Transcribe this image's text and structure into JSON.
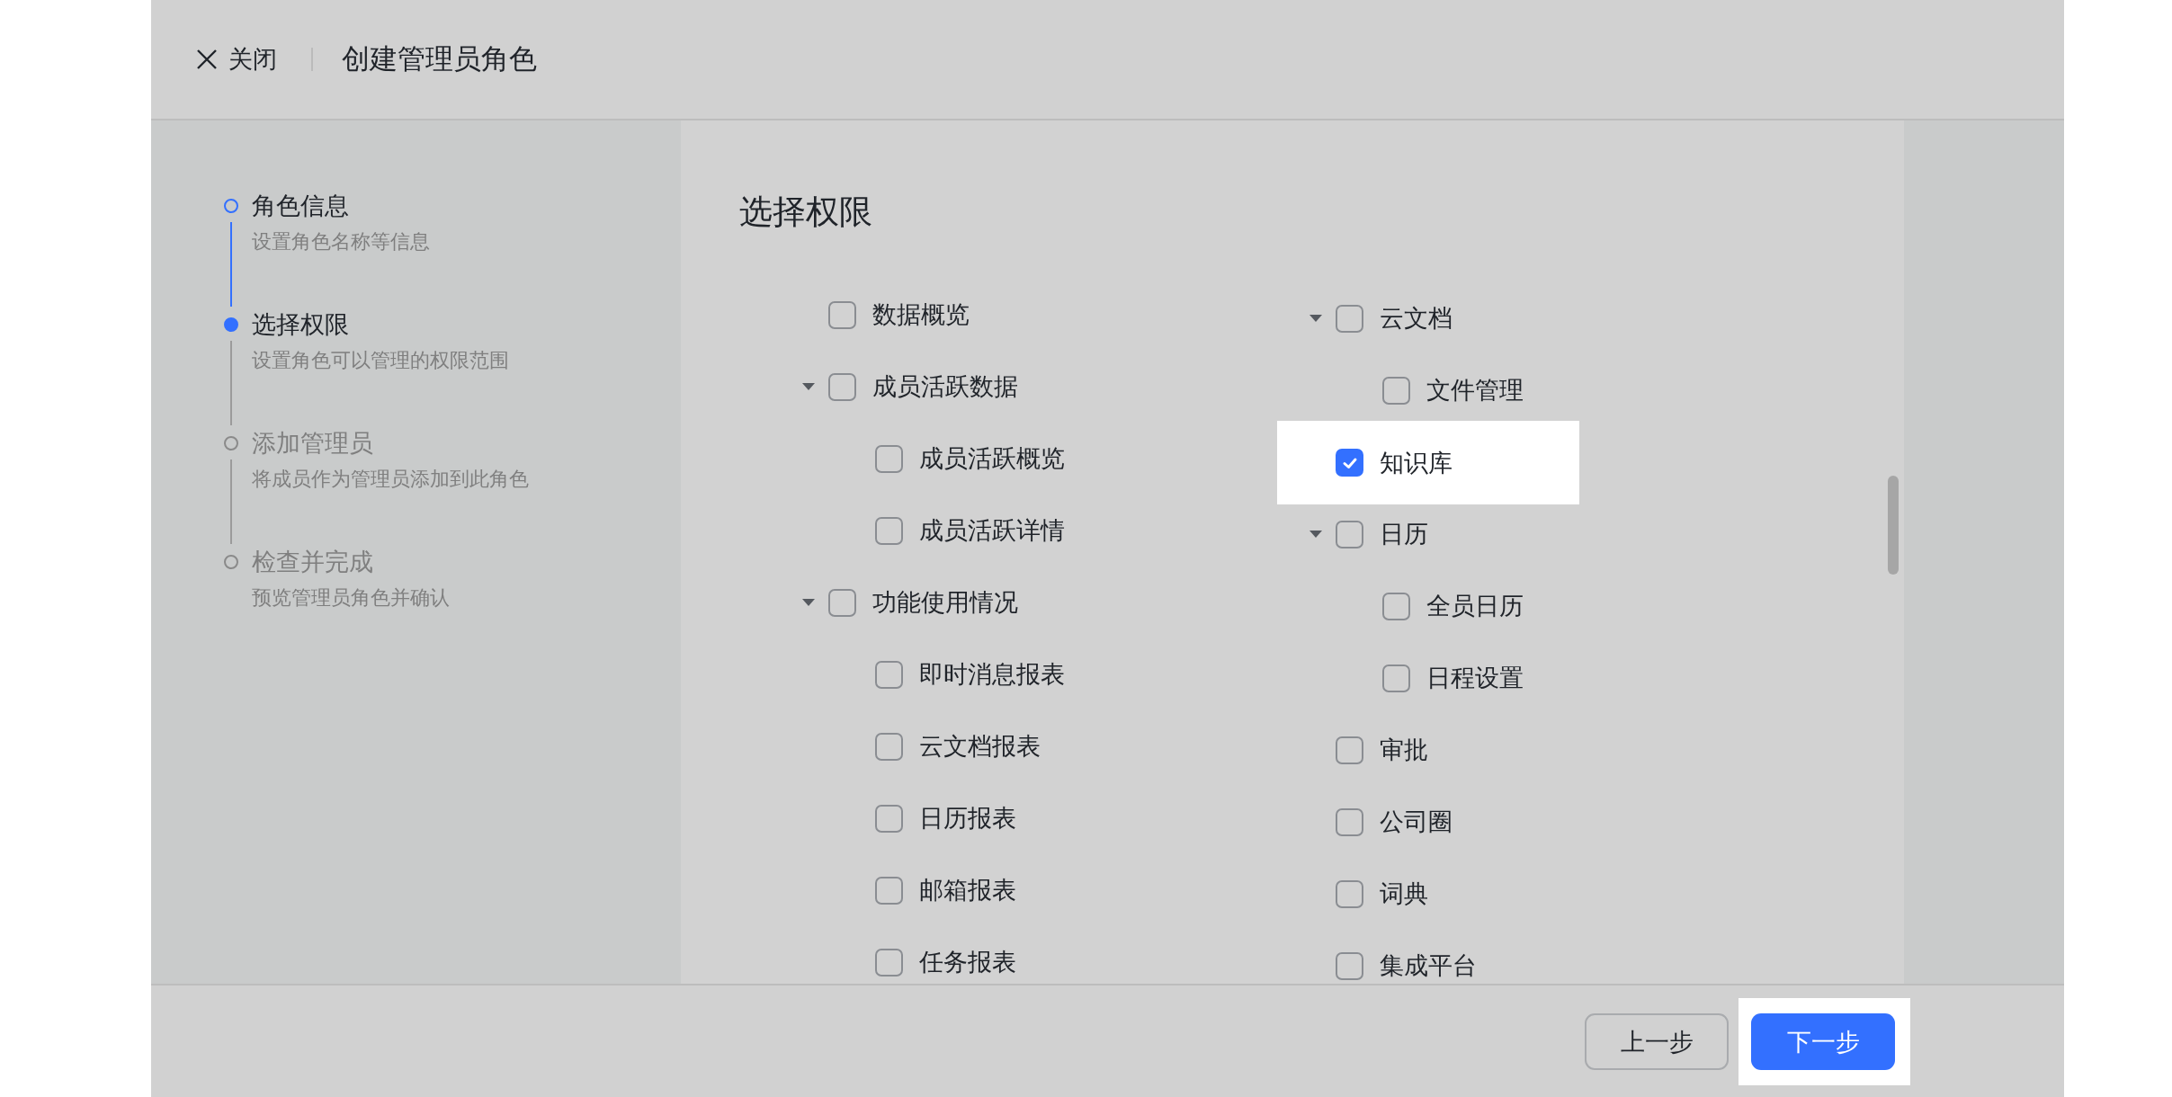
{
  "header": {
    "close_label": "关闭",
    "title": "创建管理员角色"
  },
  "steps": [
    {
      "title": "角色信息",
      "description": "设置角色名称等信息",
      "completed": true,
      "selected": false
    },
    {
      "title": "选择权限",
      "description": "设置角色可以管理的权限范围",
      "completed": false,
      "selected": true
    },
    {
      "title": "添加管理员",
      "description": "将成员作为管理员添加到此角色",
      "completed": false,
      "selected": false
    },
    {
      "title": "检查并完成",
      "description": "预览管理员角色并确认",
      "completed": false,
      "selected": false
    }
  ],
  "permissions": {
    "title": "选择权限",
    "columns": [
      [
        {
          "label": "数据概览",
          "checked": false,
          "highlighted": false
        },
        {
          "label": "成员活跃数据",
          "checked": false,
          "highlighted": false,
          "expanded": true,
          "children": [
            {
              "label": "成员活跃概览",
              "checked": false,
              "highlighted": false
            },
            {
              "label": "成员活跃详情",
              "checked": false,
              "highlighted": false
            }
          ]
        },
        {
          "label": "功能使用情况",
          "checked": false,
          "highlighted": false,
          "expanded": true,
          "children": [
            {
              "label": "即时消息报表",
              "checked": false,
              "highlighted": false
            },
            {
              "label": "云文档报表",
              "checked": false,
              "highlighted": false
            },
            {
              "label": "日历报表",
              "checked": false,
              "highlighted": false
            },
            {
              "label": "邮箱报表",
              "checked": false,
              "highlighted": false
            },
            {
              "label": "任务报表",
              "checked": false,
              "highlighted": false
            }
          ]
        }
      ],
      [
        {
          "label": "云文档",
          "checked": false,
          "highlighted": false,
          "expanded": true,
          "children": [
            {
              "label": "文件管理",
              "checked": false,
              "highlighted": false
            }
          ]
        },
        {
          "label": "知识库",
          "checked": true,
          "highlighted": true
        },
        {
          "label": "日历",
          "checked": false,
          "highlighted": false,
          "expanded": true,
          "children": [
            {
              "label": "全员日历",
              "checked": false,
              "highlighted": false
            },
            {
              "label": "日程设置",
              "checked": false,
              "highlighted": false
            }
          ]
        },
        {
          "label": "审批",
          "checked": false,
          "highlighted": false
        },
        {
          "label": "公司圈",
          "checked": false,
          "highlighted": false
        },
        {
          "label": "词典",
          "checked": false,
          "highlighted": false
        },
        {
          "label": "集成平台",
          "checked": false,
          "highlighted": false
        }
      ]
    ]
  },
  "footer": {
    "buttons": [
      {
        "label": "上一步",
        "kind": "secondary",
        "highlighted": false
      },
      {
        "label": "下一步",
        "kind": "primary",
        "highlighted": true
      }
    ]
  }
}
